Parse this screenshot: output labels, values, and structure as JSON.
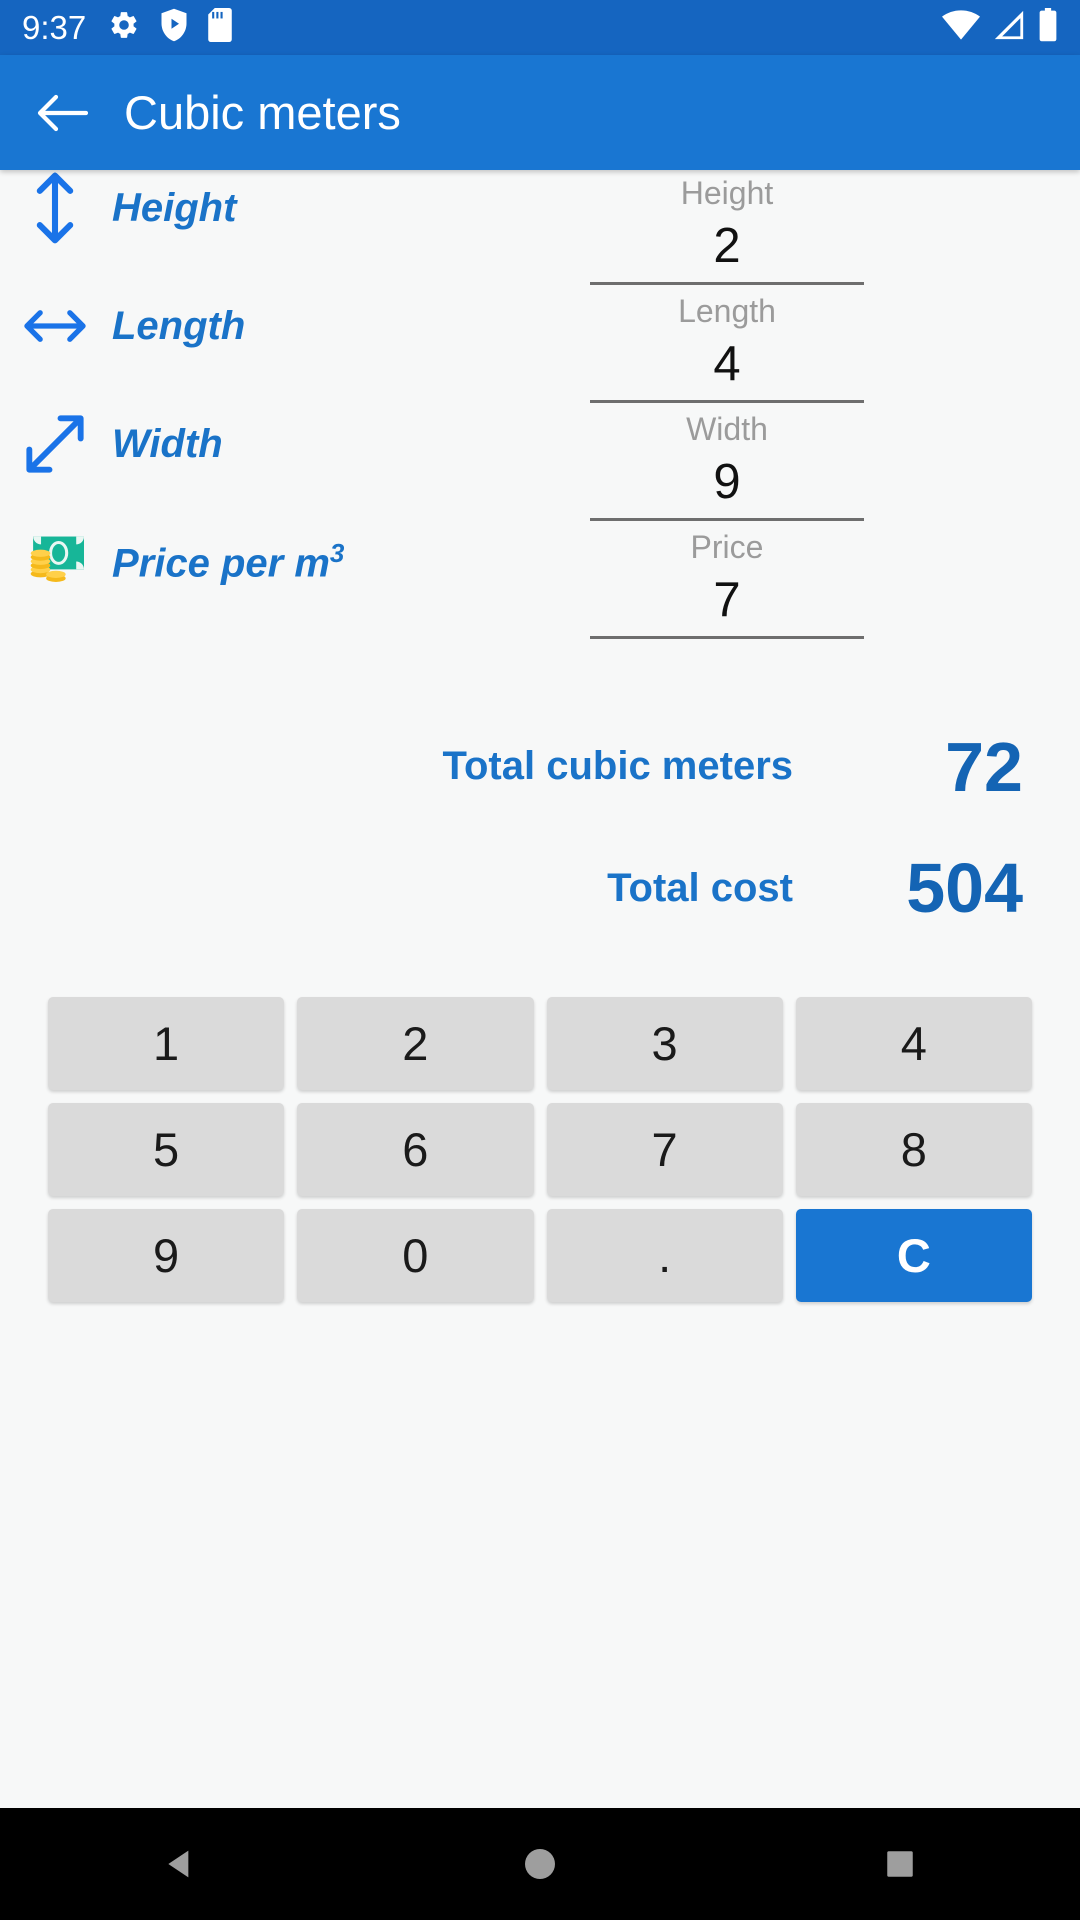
{
  "status_bar": {
    "time": "9:37",
    "left_icons": [
      "gear-icon",
      "shield-play-icon",
      "sd-card-icon"
    ],
    "right_icons": [
      "wifi-icon",
      "cell-signal-icon",
      "battery-icon"
    ],
    "background_color": "#1565c0"
  },
  "app_bar": {
    "back_label": "back-arrow",
    "title": "Cubic meters",
    "background_color": "#1976d2",
    "text_color": "#ffffff"
  },
  "accent_color": "#1976d2",
  "label_color": "#1a73c8",
  "fields": [
    {
      "icon": "vertical-double-arrow-icon",
      "label": "Height",
      "sup": "",
      "input_label": "Height",
      "value": "2"
    },
    {
      "icon": "horizontal-double-arrow-icon",
      "label": "Length",
      "sup": "",
      "input_label": "Length",
      "value": "4"
    },
    {
      "icon": "diagonal-double-arrow-icon",
      "label": "Width",
      "sup": "",
      "input_label": "Width",
      "value": "9"
    },
    {
      "icon": "money-banknote-icon",
      "label": "Price per m",
      "sup": "3",
      "input_label": "Price",
      "value": "7"
    }
  ],
  "totals": [
    {
      "label": "Total cubic meters",
      "value": "72"
    },
    {
      "label": "Total cost",
      "value": "504"
    }
  ],
  "keypad": {
    "rows": [
      [
        {
          "label": "1",
          "accent": false
        },
        {
          "label": "2",
          "accent": false
        },
        {
          "label": "3",
          "accent": false
        },
        {
          "label": "4",
          "accent": false
        }
      ],
      [
        {
          "label": "5",
          "accent": false
        },
        {
          "label": "6",
          "accent": false
        },
        {
          "label": "7",
          "accent": false
        },
        {
          "label": "8",
          "accent": false
        }
      ],
      [
        {
          "label": "9",
          "accent": false
        },
        {
          "label": "0",
          "accent": false
        },
        {
          "label": ".",
          "accent": false
        },
        {
          "label": "C",
          "accent": true
        }
      ]
    ],
    "key_background": "#dadada",
    "accent_background": "#1976d2"
  },
  "nav_bar": {
    "buttons": [
      "back-triangle-icon",
      "home-circle-icon",
      "recents-square-icon"
    ],
    "background_color": "#000000"
  }
}
